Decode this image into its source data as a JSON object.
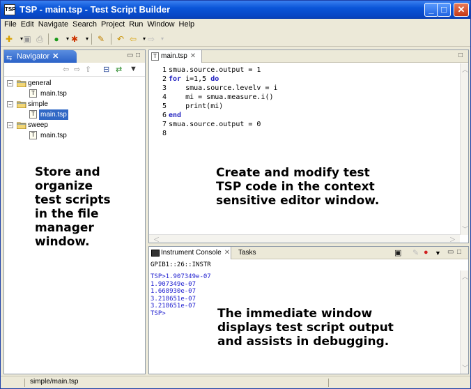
{
  "window": {
    "title": "TSP - main.tsp - Test Script Builder",
    "app_icon": "TSP",
    "controls": {
      "minimize": "_",
      "maximize": "□",
      "close": "✕"
    }
  },
  "menu": [
    "File",
    "Edit",
    "Navigate",
    "Search",
    "Project",
    "Run",
    "Window",
    "Help"
  ],
  "toolbar_icons": [
    "new-file-icon",
    "save-icon",
    "print-icon",
    "run-icon",
    "debug-icon",
    "pencil-icon",
    "back-icon",
    "forward-icon"
  ],
  "navigator": {
    "tab_label": "Navigator",
    "tree": [
      {
        "label": "general",
        "type": "folder",
        "children": [
          {
            "label": "main.tsp",
            "selected": false
          }
        ]
      },
      {
        "label": "simple",
        "type": "folder",
        "children": [
          {
            "label": "main.tsp",
            "selected": true
          }
        ]
      },
      {
        "label": "sweep",
        "type": "folder",
        "children": [
          {
            "label": "main.tsp",
            "selected": false
          }
        ]
      }
    ],
    "callout": [
      "Store and",
      "organize",
      "test scripts",
      "in the file",
      "manager",
      "window."
    ]
  },
  "editor": {
    "tab_label": "main.tsp",
    "lines": [
      {
        "n": "1",
        "code": "smua.source.output = 1"
      },
      {
        "n": "2",
        "kw": "for",
        "code": " i=1,5 ",
        "kw2": "do"
      },
      {
        "n": "3",
        "code": "    smua.source.levelv = i"
      },
      {
        "n": "4",
        "code": "    mi = smua.measure.i()"
      },
      {
        "n": "5",
        "code": "    print(mi)"
      },
      {
        "n": "6",
        "kw": "end",
        "code": ""
      },
      {
        "n": "7",
        "code": "smua.source.output = 0"
      },
      {
        "n": "8",
        "code": ""
      }
    ],
    "callout": [
      "Create and modify test",
      "TSP code in the context",
      "sensitive editor window."
    ]
  },
  "console": {
    "tab_label": "Instrument Console",
    "tasks_label": "Tasks",
    "address": "GPIB1::26::INSTR",
    "output": [
      "TSP>1.907349e-07",
      "1.907349e-07",
      "1.668930e-07",
      "3.218651e-07",
      "3.218651e-07",
      "TSP>"
    ],
    "callout": [
      "The immediate window",
      "displays test script output",
      "and assists in debugging."
    ]
  },
  "status": {
    "path": "simple/main.tsp"
  }
}
